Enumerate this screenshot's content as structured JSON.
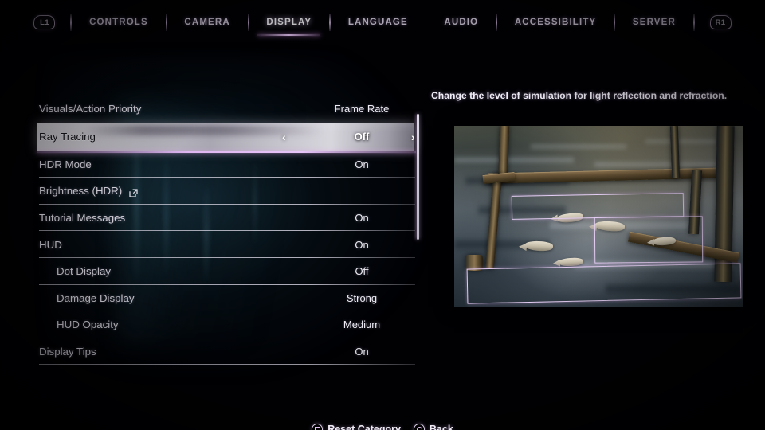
{
  "nav": {
    "left_bumper": "L1",
    "right_bumper": "R1",
    "tabs": [
      {
        "label": "CONTROLS",
        "active": false
      },
      {
        "label": "CAMERA",
        "active": false
      },
      {
        "label": "DISPLAY",
        "active": true
      },
      {
        "label": "LANGUAGE",
        "active": false
      },
      {
        "label": "AUDIO",
        "active": false
      },
      {
        "label": "ACCESSIBILITY",
        "active": false
      },
      {
        "label": "SERVER",
        "active": false
      }
    ]
  },
  "settings": {
    "rows": [
      {
        "label": "Visuals/Action Priority",
        "value": "Frame Rate",
        "indent": false,
        "selected": false,
        "ext_link": false
      },
      {
        "label": "Ray Tracing",
        "value": "Off",
        "indent": false,
        "selected": true,
        "ext_link": false
      },
      {
        "label": "HDR Mode",
        "value": "On",
        "indent": false,
        "selected": false,
        "ext_link": false
      },
      {
        "label": "Brightness (HDR)",
        "value": "",
        "indent": false,
        "selected": false,
        "ext_link": true
      },
      {
        "label": "Tutorial Messages",
        "value": "On",
        "indent": false,
        "selected": false,
        "ext_link": false
      },
      {
        "label": "HUD",
        "value": "On",
        "indent": false,
        "selected": false,
        "ext_link": false
      },
      {
        "label": "Dot Display",
        "value": "Off",
        "indent": true,
        "selected": false,
        "ext_link": false
      },
      {
        "label": "Damage Display",
        "value": "Strong",
        "indent": true,
        "selected": false,
        "ext_link": false
      },
      {
        "label": "HUD Opacity",
        "value": "Medium",
        "indent": true,
        "selected": false,
        "ext_link": false
      },
      {
        "label": "Display Tips",
        "value": "On",
        "indent": false,
        "selected": false,
        "ext_link": false
      }
    ],
    "selector_left_arrow": "‹",
    "selector_right_arrow": "›"
  },
  "detail": {
    "description": "Change the level of simulation for light reflection and refraction."
  },
  "footer": {
    "hints": [
      {
        "glyph": "square-button-icon",
        "label": "Reset Category"
      },
      {
        "glyph": "circle-button-icon",
        "label": "Back"
      }
    ]
  },
  "colors": {
    "accent_purple": "#e4bff5",
    "text_primary": "#e9e6f0",
    "highlight_row": "#c2c0c9",
    "background": "#010104"
  }
}
